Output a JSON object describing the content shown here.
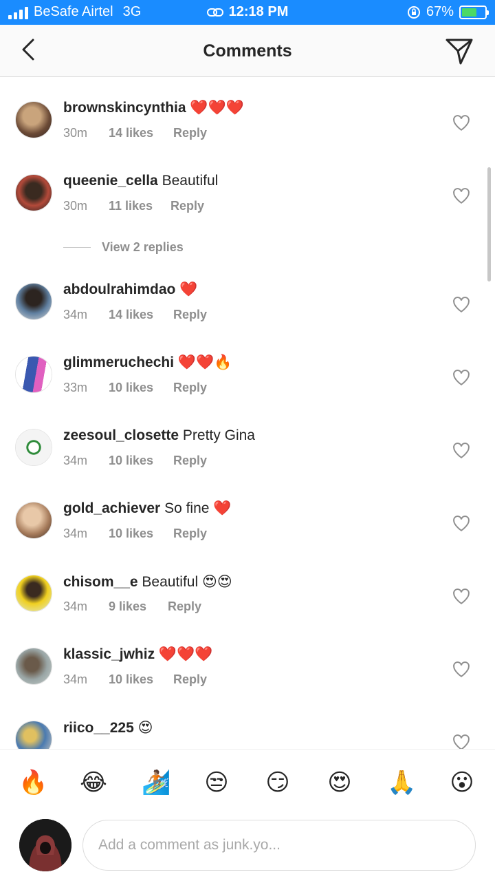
{
  "status_bar": {
    "carrier": "BeSafe Airtel",
    "network": "3G",
    "time": "12:18 PM",
    "battery": "67%",
    "battery_level": 0.67
  },
  "header": {
    "title": "Comments",
    "back_icon": "chevron-left-icon",
    "send_icon": "paper-plane-icon"
  },
  "comments": [
    {
      "user": "brownskincynthia",
      "text": "",
      "emoji": "❤️❤️❤️",
      "time": "30m",
      "likes": "14 likes",
      "reply": "Reply"
    },
    {
      "user": "queenie_cella",
      "text": "Beautiful",
      "emoji": "",
      "time": "30m",
      "likes": "11 likes",
      "reply": "Reply"
    },
    {
      "user": "abdoulrahimdao",
      "text": "",
      "emoji": "❤️",
      "time": "34m",
      "likes": "14 likes",
      "reply": "Reply"
    },
    {
      "user": "glimmeruchechi",
      "text": "",
      "emoji": "❤️❤️🔥",
      "time": "33m",
      "likes": "10 likes",
      "reply": "Reply"
    },
    {
      "user": "zeesoul_closette",
      "text": "Pretty Gina",
      "emoji": "",
      "time": "34m",
      "likes": "10 likes",
      "reply": "Reply"
    },
    {
      "user": "gold_achiever",
      "text": "So fine",
      "emoji": "❤️",
      "time": "34m",
      "likes": "10 likes",
      "reply": "Reply"
    },
    {
      "user": "chisom__e",
      "text": "Beautiful",
      "emoji": "😍😍",
      "time": "34m",
      "likes": "9 likes",
      "reply": "Reply"
    },
    {
      "user": "klassic_jwhiz",
      "text": "",
      "emoji": "❤️❤️❤️",
      "time": "34m",
      "likes": "10 likes",
      "reply": "Reply"
    },
    {
      "user": "riico__225",
      "text": "",
      "emoji": "😍",
      "time": "",
      "likes": "",
      "reply": ""
    }
  ],
  "view_replies": "View 2 replies",
  "quick_emojis": [
    "🔥",
    "😂",
    "🏄🏽",
    "😒",
    "😏",
    "😍",
    "🙏",
    "😮"
  ],
  "input": {
    "placeholder": "Add a comment as junk.yo..."
  },
  "colors": {
    "status_bar": "#1a8cff",
    "muted_text": "#8e8e8e",
    "border": "#dbdbdb"
  }
}
